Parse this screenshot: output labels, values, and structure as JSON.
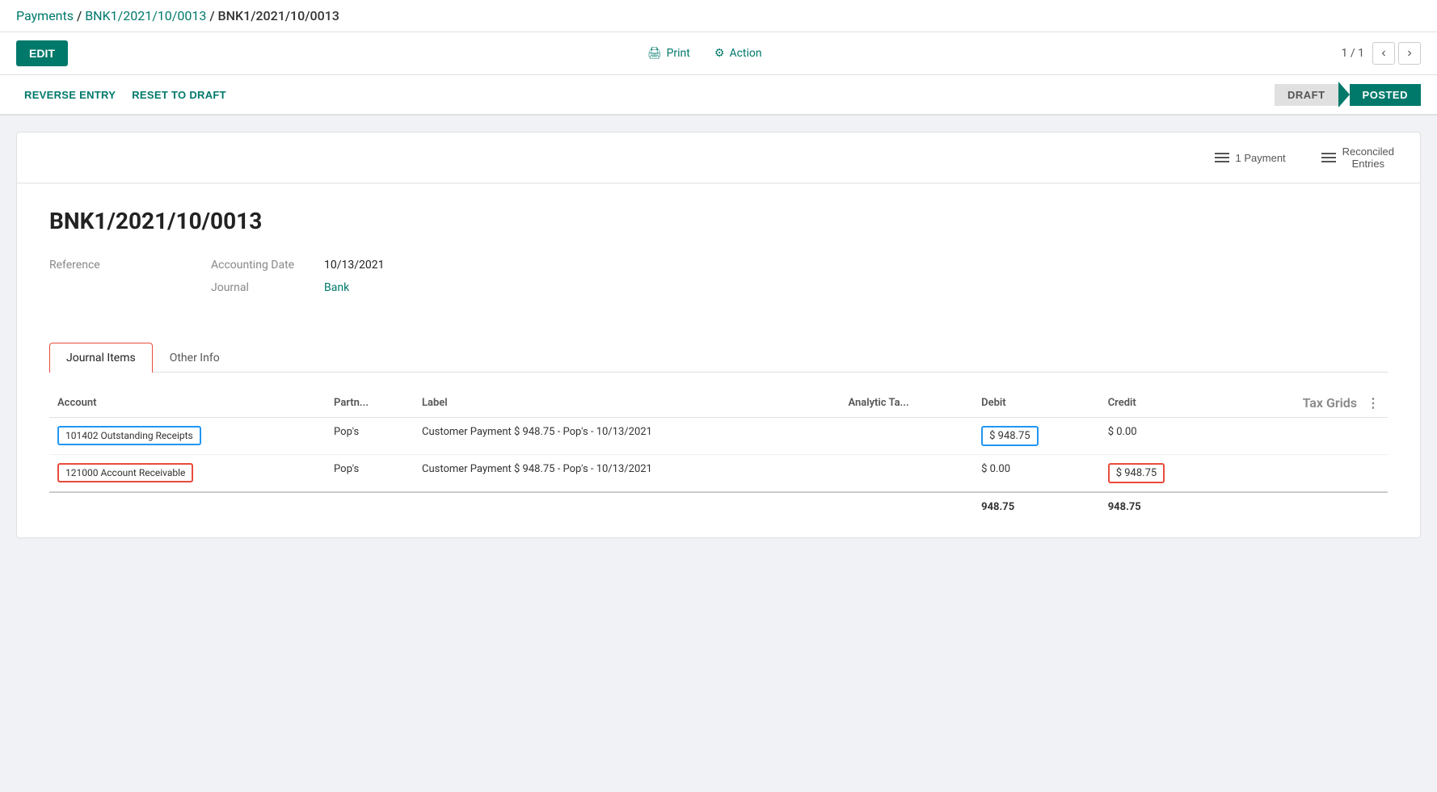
{
  "breadcrumb": {
    "parent1": "Payments",
    "parent2": "BNK1/2021/10/0013",
    "current": "BNK1/2021/10/0013"
  },
  "toolbar": {
    "edit_label": "EDIT",
    "print_label": "Print",
    "action_label": "Action",
    "pagination": "1 / 1"
  },
  "statusBar": {
    "reverse_entry": "REVERSE ENTRY",
    "reset_to_draft": "RESET TO DRAFT",
    "status_draft": "DRAFT",
    "status_posted": "POSTED"
  },
  "smartButtons": {
    "payment_label": "1 Payment",
    "reconciled_label": "Reconciled",
    "reconciled_label2": "Entries"
  },
  "form": {
    "title": "BNK1/2021/10/0013",
    "reference_label": "Reference",
    "reference_value": "",
    "accounting_date_label": "Accounting Date",
    "accounting_date_value": "10/13/2021",
    "journal_label": "Journal",
    "journal_value": "Bank"
  },
  "tabs": [
    {
      "label": "Journal Items",
      "active": true
    },
    {
      "label": "Other Info",
      "active": false
    }
  ],
  "table": {
    "columns": [
      "Account",
      "Partn...",
      "Label",
      "Analytic Ta...",
      "Debit",
      "Credit",
      "Tax Grids"
    ],
    "rows": [
      {
        "account": "101402 Outstanding Receipts",
        "account_style": "blue",
        "partner": "Pop's",
        "label": "Customer Payment $ 948.75 - Pop's - 10/13/2021",
        "analytic": "",
        "debit": "$ 948.75",
        "debit_style": "blue",
        "credit": "$ 0.00",
        "credit_style": "plain"
      },
      {
        "account": "121000 Account Receivable",
        "account_style": "red",
        "partner": "Pop's",
        "label": "Customer Payment $ 948.75 - Pop's - 10/13/2021",
        "analytic": "",
        "debit": "$ 0.00",
        "debit_style": "plain",
        "credit": "$ 948.75",
        "credit_style": "red"
      }
    ],
    "totals": {
      "debit": "948.75",
      "credit": "948.75"
    }
  },
  "icons": {
    "print": "🖨",
    "gear": "⚙",
    "chevron_left": "‹",
    "chevron_right": "›",
    "lines": "≡"
  }
}
